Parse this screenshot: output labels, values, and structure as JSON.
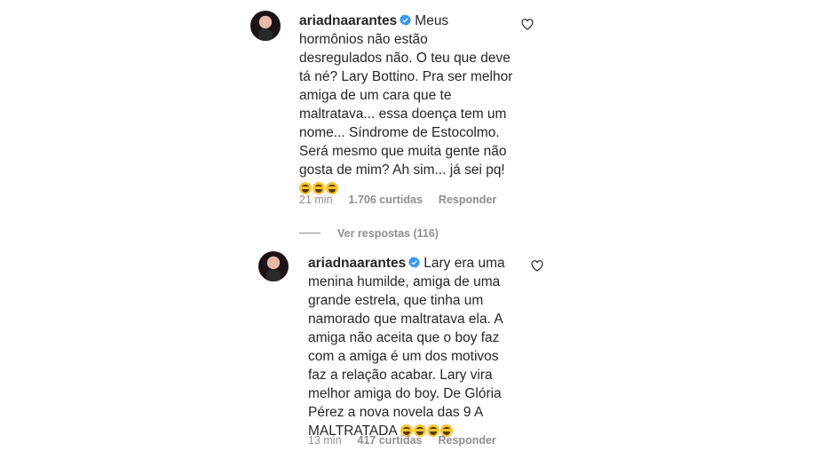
{
  "comments": [
    {
      "username": "ariadnaarantes",
      "text": "Meus\nhormônios não estão\ndesregulados não. O teu que deve\ntá né? Lary Bottino. Pra ser melhor\namiga de um cara que te\nmaltratava... essa doença tem um\nnome... Síndrome de Estocolmo.\nSerá mesmo que muita gente não\ngosta de mim? Ah sim... já sei pq!",
      "emoji_count": 3,
      "time": "21 min",
      "likes": "1.706 curtidas",
      "reply_label": "Responder",
      "view_replies": "Ver respostas (116)"
    },
    {
      "username": "ariadnaarantes",
      "text": "Lary era uma\nmenina humilde, amiga de uma\ngrande estrela, que tinha um\nnamorado que maltratava ela. A\namiga não aceita que o boy faz\ncom a amiga é um dos motivos\nfaz a relação acabar. Lary vira\nmelhor amiga do boy. De Glória\nPérez a nova novela das 9 A\nMALTRATADA",
      "emoji_count": 4,
      "time": "13 min",
      "likes": "417 curtidas",
      "reply_label": "Responder"
    }
  ],
  "icons": {
    "verified": "verified-badge-icon",
    "like": "heart-outline-icon",
    "emoji": "rolling-laughing-emoji"
  },
  "colors": {
    "verified": "#3897f0",
    "muted": "#8e8e8e",
    "text": "#262626"
  }
}
